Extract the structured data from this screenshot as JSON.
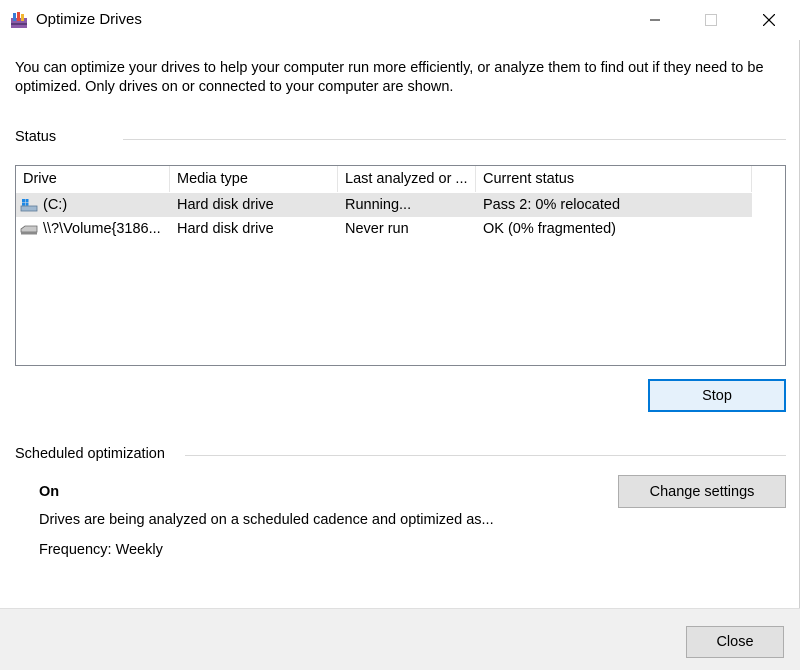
{
  "window": {
    "title": "Optimize Drives",
    "minimize_glyph": "—",
    "close_glyph": "✕"
  },
  "intro": "You can optimize your drives to help your computer run more efficiently, or analyze them to find out if they need to be optimized. Only drives on or connected to your computer are shown.",
  "status": {
    "label": "Status",
    "columns": [
      "Drive",
      "Media type",
      "Last analyzed or ...",
      "Current status"
    ],
    "rows": [
      {
        "drive": "(C:)",
        "media_type": "Hard disk drive",
        "last_analyzed": "Running...",
        "current_status": "Pass 2: 0% relocated",
        "icon": "windows-drive-icon",
        "selected": true
      },
      {
        "drive": "\\\\?\\Volume{3186...",
        "media_type": "Hard disk drive",
        "last_analyzed": "Never run",
        "current_status": "OK (0% fragmented)",
        "icon": "hard-drive-icon",
        "selected": false
      }
    ],
    "stop_button": "Stop"
  },
  "scheduled": {
    "label": "Scheduled optimization",
    "state": "On",
    "description": "Drives are being analyzed on a scheduled cadence and optimized as...",
    "frequency": "Frequency: Weekly",
    "change_button": "Change settings"
  },
  "footer": {
    "close_button": "Close"
  },
  "colors": {
    "focus_border": "#0078d7",
    "selected_row": "#e5e5e5",
    "button_face": "#e1e1e1",
    "footer_bg": "#f0f0f0"
  }
}
